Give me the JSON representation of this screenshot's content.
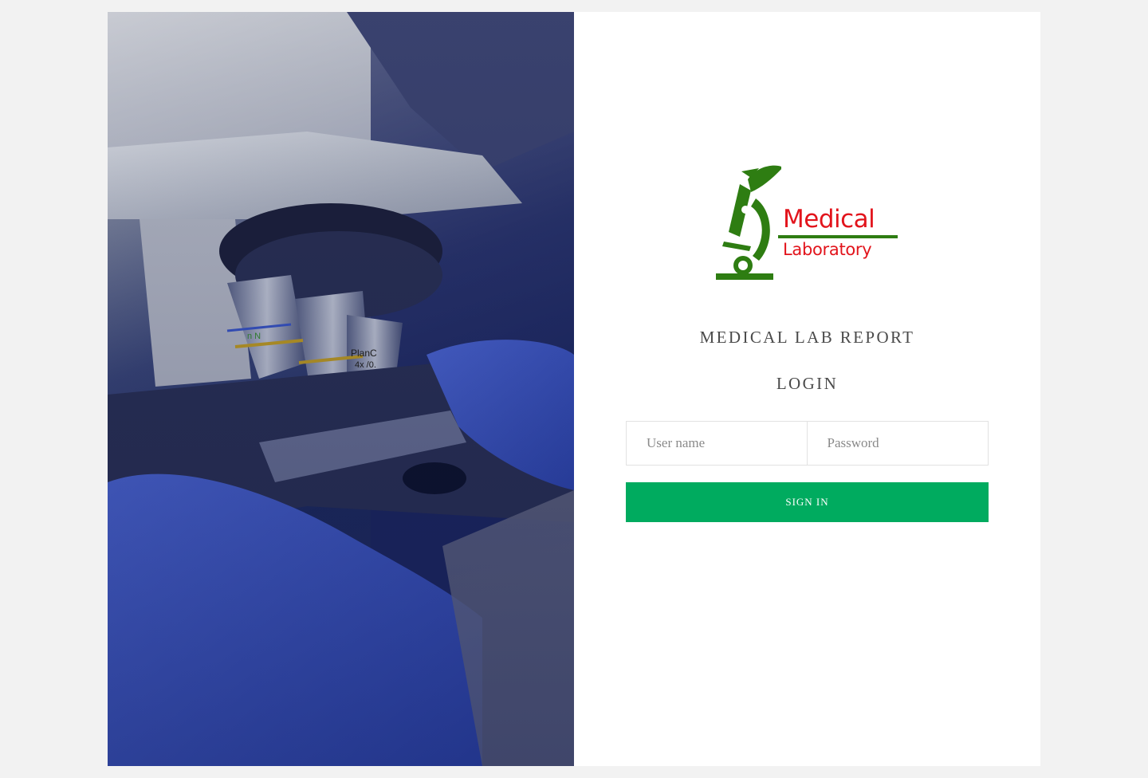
{
  "brand": {
    "logo_line1": "Medical",
    "logo_line2": "Laboratory",
    "logo_text_color": "#e2141c",
    "logo_mark_color": "#2e7d12",
    "logo_icon": "microscope-icon"
  },
  "header": {
    "app_title": "MEDICAL LAB REPORT",
    "form_title": "LOGIN"
  },
  "form": {
    "username": {
      "value": "",
      "placeholder": "User name"
    },
    "password": {
      "value": "",
      "placeholder": "Password"
    },
    "submit_label": "SIGN IN",
    "submit_color": "#00ab5f"
  },
  "hero_image": {
    "subject": "microscope-photo",
    "lens_label_1": "PlanC",
    "lens_label_2": "4x /0.",
    "lens_label_3": "n N"
  },
  "colors": {
    "page_background": "#f2f2f2",
    "panel_background": "#ffffff",
    "title_text": "#4a4a4a"
  }
}
